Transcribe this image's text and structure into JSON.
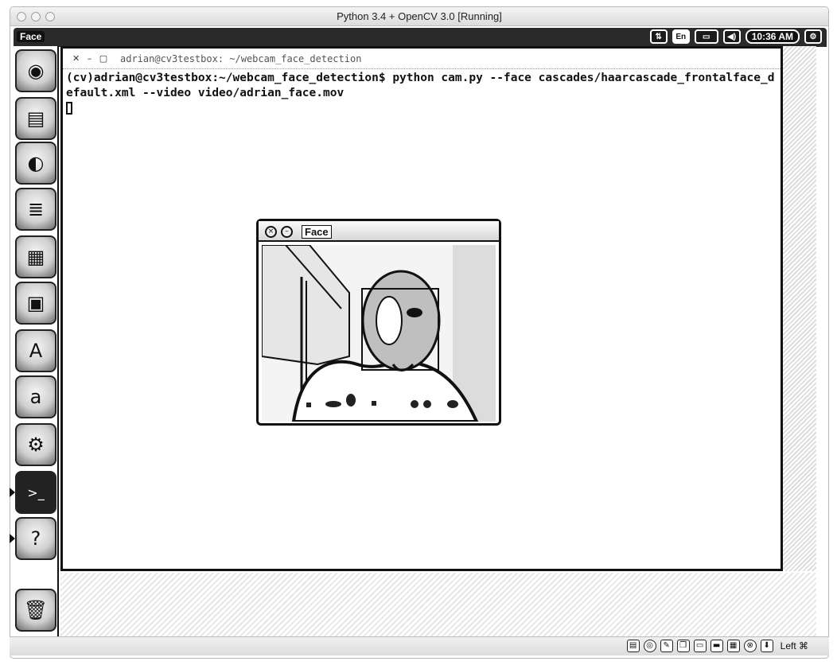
{
  "mac_window": {
    "title": "Python 3.4 + OpenCV 3.0 [Running]"
  },
  "ubuntu_panel": {
    "app_name": "Face",
    "input_language": "En",
    "clock": "10:36 AM"
  },
  "launcher": {
    "items": [
      {
        "name": "dash",
        "glyph": "◉"
      },
      {
        "name": "files",
        "glyph": "▤"
      },
      {
        "name": "firefox",
        "glyph": "◐"
      },
      {
        "name": "writer",
        "glyph": "≣"
      },
      {
        "name": "calc",
        "glyph": "▦"
      },
      {
        "name": "impress",
        "glyph": "▣"
      },
      {
        "name": "software-center",
        "glyph": "A"
      },
      {
        "name": "amazon",
        "glyph": "a"
      },
      {
        "name": "settings",
        "glyph": "⚙"
      },
      {
        "name": "terminal",
        "glyph": ">_"
      },
      {
        "name": "help",
        "glyph": "?"
      },
      {
        "name": "trash",
        "glyph": "🗑"
      }
    ]
  },
  "terminal": {
    "title": "adrian@cv3testbox: ~/webcam_face_detection",
    "prompt": "(cv)adrian@cv3testbox:~/webcam_face_detection$ ",
    "command": "python cam.py --face cascades/haarcascade_frontalface_default.xml --video video/adrian_face.mov"
  },
  "face_window": {
    "title": "Face"
  },
  "vm_status": {
    "host_key": "Left ⌘"
  }
}
